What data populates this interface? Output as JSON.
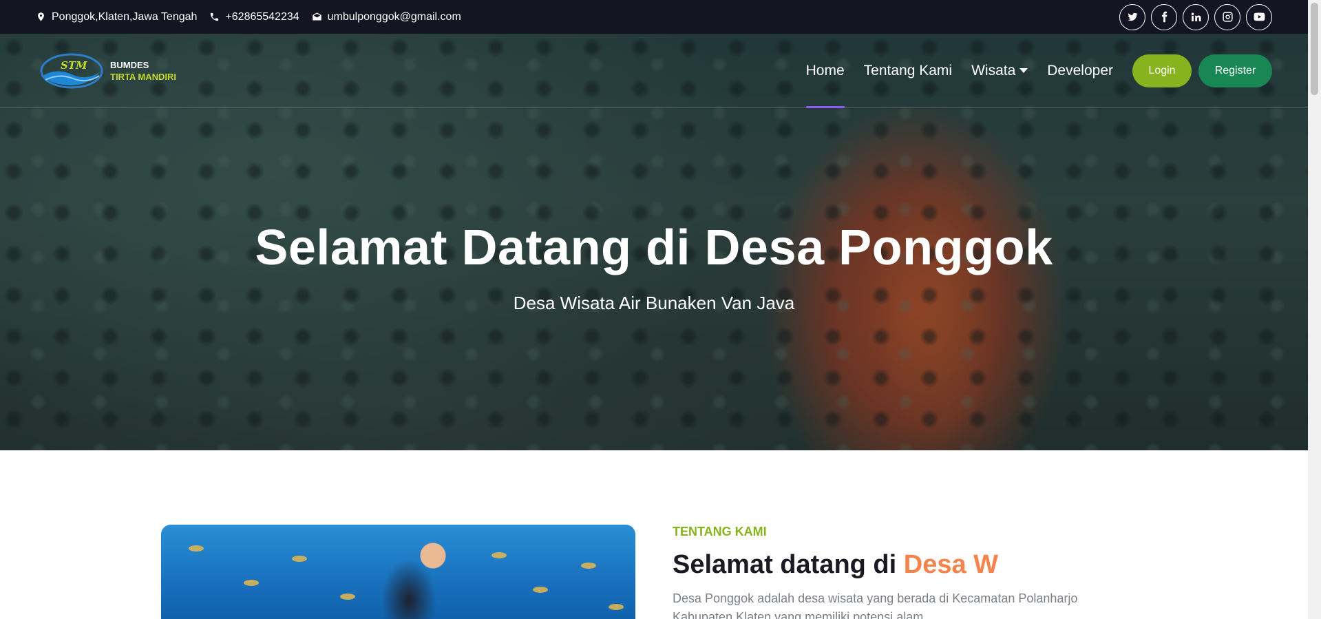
{
  "topbar": {
    "location": "Ponggok,Klaten,Jawa Tengah",
    "phone": "+62865542234",
    "email": "umbulponggok@gmail.com",
    "socials": [
      "twitter-icon",
      "facebook-icon",
      "linkedin-icon",
      "instagram-icon",
      "youtube-icon"
    ]
  },
  "brand": {
    "logo_text": "STM",
    "line1": "BUMDES",
    "line2": "TIRTA MANDIRI"
  },
  "nav": {
    "items": [
      {
        "label": "Home",
        "active": true
      },
      {
        "label": "Tentang Kami",
        "active": false
      },
      {
        "label": "Wisata",
        "active": false,
        "dropdown": true
      },
      {
        "label": "Developer",
        "active": false
      }
    ],
    "login": "Login",
    "register": "Register"
  },
  "hero": {
    "title": "Selamat Datang di Desa Ponggok",
    "subtitle": "Desa Wisata Air Bunaken Van Java"
  },
  "about": {
    "kicker": "TENTANG KAMI",
    "title_prefix": "Selamat datang di ",
    "title_accent": "Desa Wis",
    "description": "Desa Ponggok adalah desa wisata yang berada di Kecamatan Polanharjo Kabupaten Klaten yang memiliki potensi alam"
  },
  "colors": {
    "topbar_bg": "#141422",
    "accent_green": "#86b31e",
    "register_green": "#198754",
    "accent_orange": "#f4834c",
    "nav_active": "#8b5cf6"
  }
}
